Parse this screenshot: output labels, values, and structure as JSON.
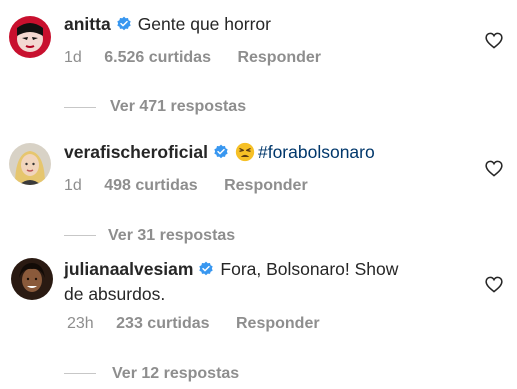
{
  "comments": [
    {
      "username": "anitta",
      "verified": true,
      "text": "Gente que horror",
      "time": "1d",
      "likes": "6.526 curtidas",
      "reply": "Responder",
      "view_replies": "Ver 471 respostas"
    },
    {
      "username": "verafischeroficial",
      "verified": true,
      "emoji": "tired-face-emoji",
      "text": "#forabolsonaro",
      "time": "1d",
      "likes": "498 curtidas",
      "reply": "Responder",
      "view_replies": "Ver 31 respostas"
    },
    {
      "username": "julianaalvesiam",
      "verified": true,
      "text_line1": "Fora, Bolsonaro! Show",
      "text_line2": "de absurdos.",
      "time": "23h",
      "likes": "233 curtidas",
      "reply": "Responder",
      "view_replies": "Ver 12 respostas"
    }
  ],
  "icons": {
    "verified": "verified-badge-icon",
    "like": "heart-outline-icon"
  },
  "colors": {
    "verified_blue": "#3897f0",
    "meta_gray": "#8e8e8e",
    "hashtag": "#00376b",
    "text": "#262626"
  }
}
